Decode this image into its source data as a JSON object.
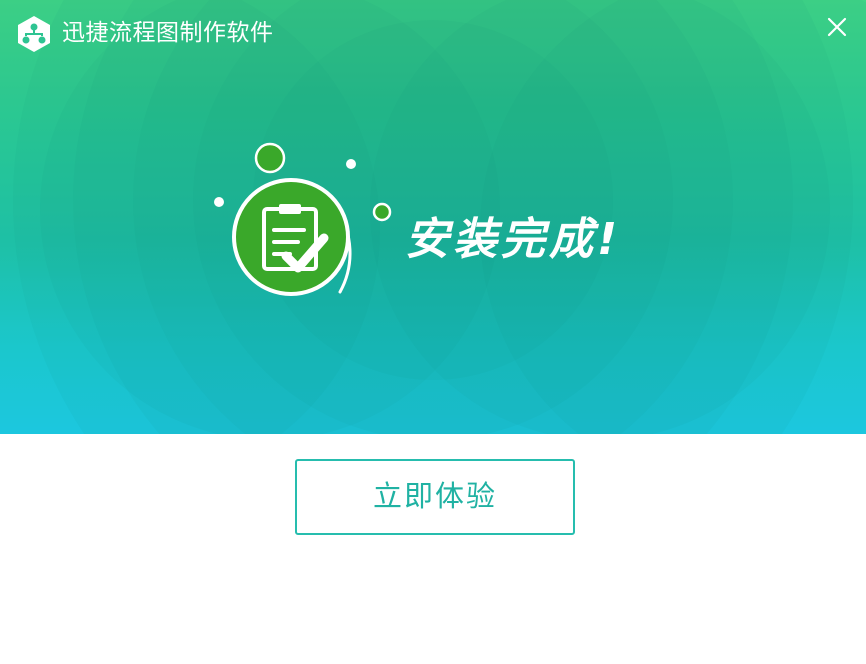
{
  "window": {
    "title": "迅捷流程图制作软件",
    "logo_icon": "flowchart-logo-icon",
    "close_icon": "close-icon"
  },
  "banner": {
    "status_text": "安装完成!",
    "badge_icon": "clipboard-check-icon",
    "gradient_colors": [
      "#3fd486",
      "#1fc4a8",
      "#1dcbe6"
    ],
    "badge_color": "#3aa82a"
  },
  "actions": {
    "primary_label": "立即体验",
    "primary_color": "#20b2a3"
  }
}
